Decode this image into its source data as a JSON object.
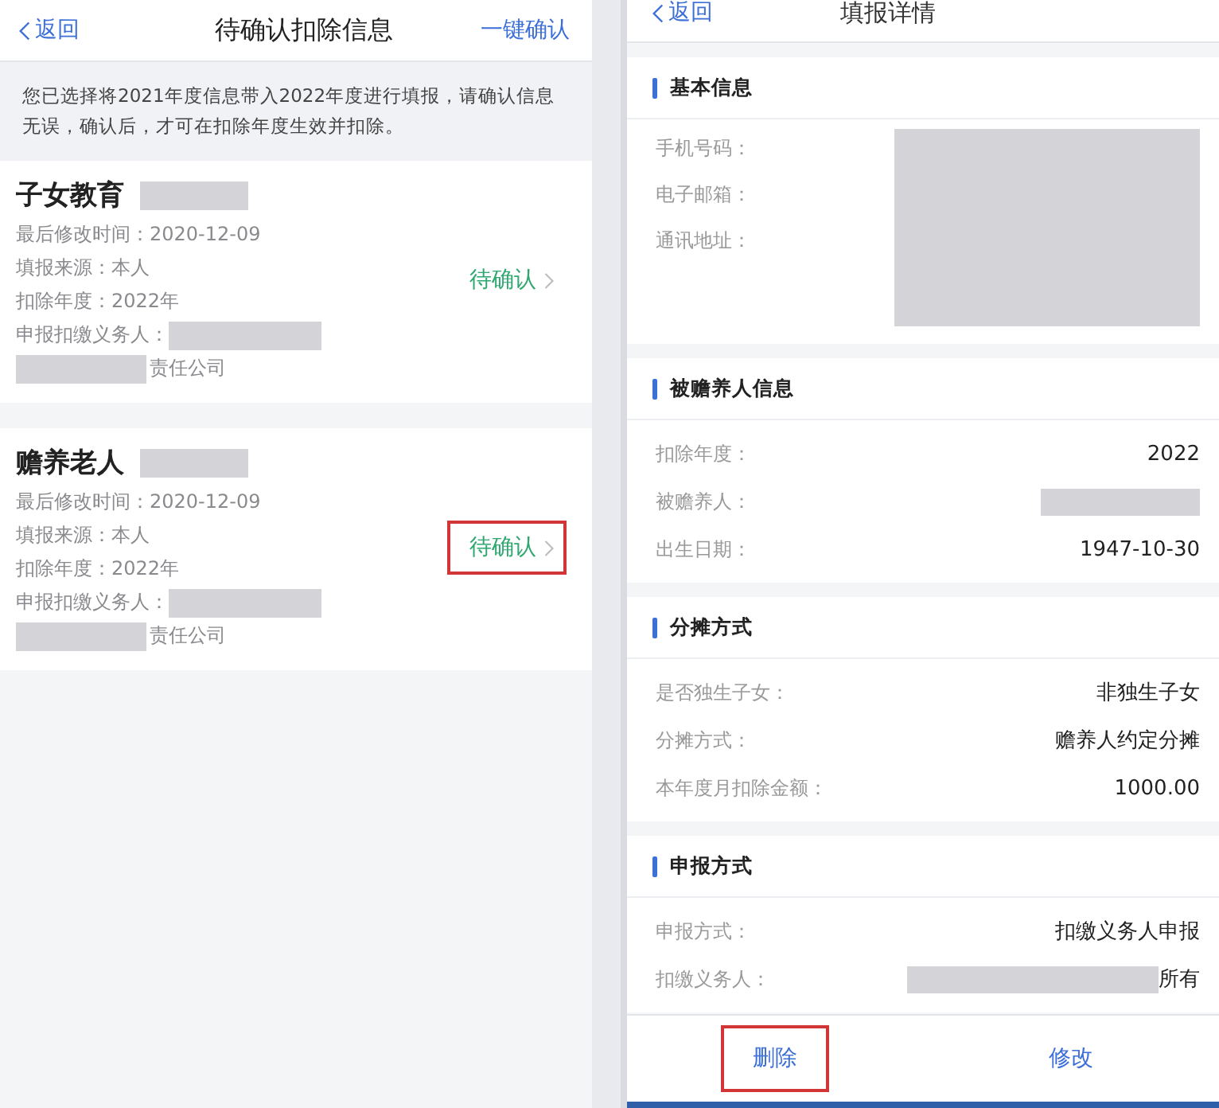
{
  "left_screen": {
    "header": {
      "back": "返回",
      "title": "待确认扣除信息",
      "action": "一键确认"
    },
    "notice": "您已选择将2021年度信息带入2022年度进行填报，请确认信息无误，确认后，才可在扣除年度生效并扣除。",
    "cards": [
      {
        "title": "子女教育",
        "title_redacted": true,
        "lines": [
          {
            "text": "最后修改时间：2020-12-09"
          },
          {
            "text": "填报来源：本人"
          },
          {
            "text": "扣除年度：2022年"
          },
          {
            "text": "申报扣缴义务人：",
            "redacted_after": true
          },
          {
            "text": "责任公司",
            "redacted_before": true
          }
        ],
        "status": {
          "label": "待确认",
          "highlighted": false
        }
      },
      {
        "title": "赡养老人",
        "title_redacted": true,
        "lines": [
          {
            "text": "最后修改时间：2020-12-09"
          },
          {
            "text": "填报来源：本人"
          },
          {
            "text": "扣除年度：2022年"
          },
          {
            "text": "申报扣缴义务人：",
            "redacted_after": true
          },
          {
            "text": "责任公司",
            "redacted_before": true
          }
        ],
        "status": {
          "label": "待确认",
          "highlighted": true
        }
      }
    ]
  },
  "right_screen": {
    "header": {
      "back": "返回",
      "title": "填报详情"
    },
    "sections": [
      {
        "title": "基本信息",
        "kind": "redacted-panel",
        "rows": [
          {
            "label": "手机号码："
          },
          {
            "label": "电子邮箱："
          },
          {
            "label": "通讯地址："
          }
        ]
      },
      {
        "title": "被赡养人信息",
        "kind": "list",
        "rows": [
          {
            "label": "扣除年度：",
            "value": "2022"
          },
          {
            "label": "被赡养人：",
            "redacted": true
          },
          {
            "label": "出生日期：",
            "value": "1947-10-30"
          }
        ]
      },
      {
        "title": "分摊方式",
        "kind": "list",
        "rows": [
          {
            "label": "是否独生子女：",
            "value": "非独生子女"
          },
          {
            "label": "分摊方式：",
            "value": "赡养人约定分摊"
          },
          {
            "label": "本年度月扣除金额：",
            "value": "1000.00"
          }
        ]
      },
      {
        "title": "申报方式",
        "kind": "list",
        "rows": [
          {
            "label": "申报方式：",
            "value": "扣缴义务人申报"
          },
          {
            "label": "扣缴义务人：",
            "value": "所有",
            "redacted": true
          }
        ]
      }
    ],
    "buttons": [
      {
        "label": "删除",
        "highlighted": true
      },
      {
        "label": "修改",
        "highlighted": false
      }
    ]
  }
}
